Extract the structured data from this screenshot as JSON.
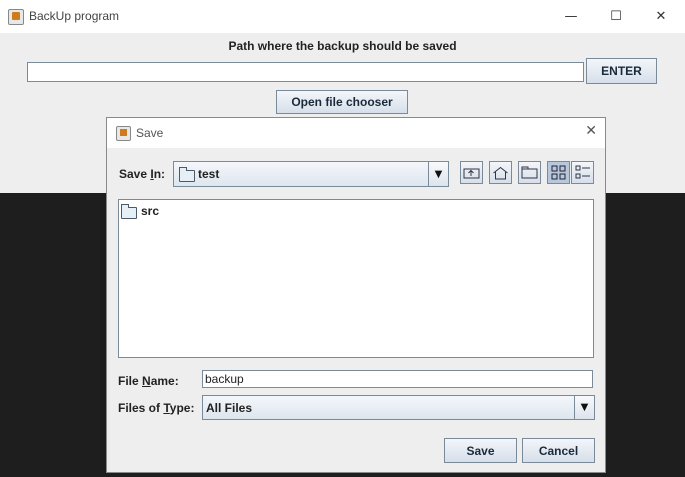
{
  "main_window": {
    "title": "BackUp program",
    "controls": {
      "minimize": "—",
      "maximize": "☐",
      "close": "✕"
    },
    "path_label": "Path where the backup should be saved",
    "path_value": "",
    "enter_button": "ENTER",
    "file_chooser_button": "Open file chooser"
  },
  "save_dialog": {
    "title": "Save",
    "close": "✕",
    "save_in_label_pre": "Save ",
    "save_in_label_key": "I",
    "save_in_label_post": "n:",
    "save_in_value": "test",
    "toolbar_icons": [
      "up-one-level-icon",
      "home-icon",
      "new-folder-icon",
      "list-view-icon",
      "details-view-icon"
    ],
    "files": [
      {
        "name": "src",
        "type": "folder"
      }
    ],
    "file_name_label_pre": "File ",
    "file_name_label_key": "N",
    "file_name_label_post": "ame:",
    "file_name_value": "backup",
    "files_of_type_label_pre": "Files of ",
    "files_of_type_label_key": "T",
    "files_of_type_label_post": "ype:",
    "files_of_type_value": "All Files",
    "save_button": "Save",
    "cancel_button": "Cancel"
  }
}
